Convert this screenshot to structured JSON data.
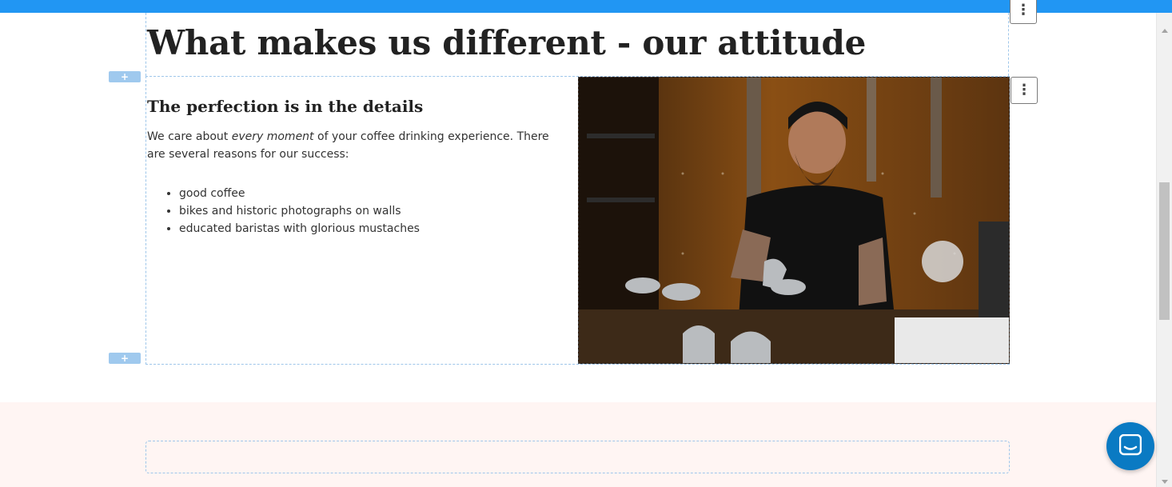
{
  "heading": {
    "title": "What makes us different - our attitude"
  },
  "content": {
    "subtitle": "The perfection is in the details",
    "paragraph_before": "We care about ",
    "paragraph_em": "every moment",
    "paragraph_after": " of your coffee drinking experience. There are several reasons for our success:",
    "list": [
      "good coffee",
      "bikes and historic photographs on walls",
      "educated baristas with glorious mustaches"
    ]
  },
  "editor": {
    "add_label": "+",
    "menu_label": "⋮"
  },
  "colors": {
    "topbar": "#2196f3",
    "guide": "#9ec6ea",
    "pink_section": "#fff5f3",
    "chat": "#0a7ac3"
  }
}
